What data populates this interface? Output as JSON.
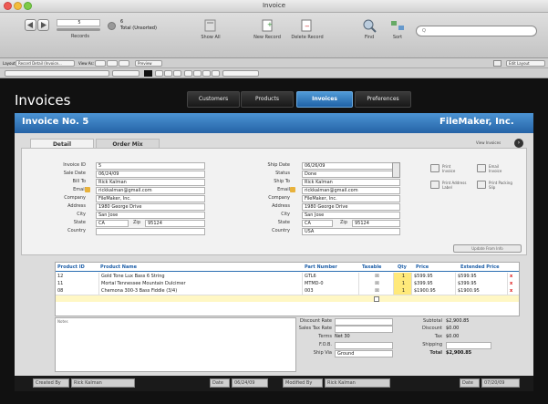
{
  "window": {
    "title": "Invoice"
  },
  "toolbar": {
    "record_value": "5",
    "records_label": "Records",
    "total_count": "6",
    "total_label": "Total (Unsorted)",
    "show_all": "Show All",
    "new_record": "New Record",
    "delete_record": "Delete Record",
    "find": "Find",
    "sort": "Sort",
    "search_placeholder": "Q"
  },
  "layoutbar": {
    "layout_label": "Layout:",
    "layout_value": "Record Detail (Invoice...",
    "view_as": "View As:",
    "preview": "Preview",
    "edit_layout": "Edit Layout"
  },
  "header": {
    "app_title": "Invoices",
    "tabs": [
      "Customers",
      "Products",
      "Invoices",
      "Preferences"
    ],
    "active_tab": "Invoices"
  },
  "invoice": {
    "title": "Invoice No. 5",
    "company": "FileMaker, Inc.",
    "subtabs": [
      "Detail",
      "Order Mix"
    ],
    "view_invoices": "View Invoices"
  },
  "billing": {
    "labels": [
      "Invoice ID",
      "Sale Date",
      "Bill To",
      "Email",
      "Company",
      "Address",
      "City",
      "State",
      "Zip",
      "Country"
    ],
    "invoice_id": "5",
    "sale_date": "06/24/09",
    "bill_to": "Rick Kalman",
    "email": "rickkalman@gmail.com",
    "company": "FileMaker, Inc.",
    "address": "1980 George Drive",
    "city": "San Jose",
    "state": "CA",
    "zip": "95124",
    "country": ""
  },
  "shipping": {
    "labels": [
      "Ship Date",
      "Status",
      "Ship To",
      "Email",
      "Company",
      "Address",
      "City",
      "State",
      "Zip",
      "Country"
    ],
    "ship_date": "06/26/09",
    "status": "Done",
    "ship_to": "Rick Kalman",
    "email": "rickkalman@gmail.com",
    "company": "FileMaker, Inc.",
    "address": "1980 George Drive",
    "city": "San Jose",
    "state": "CA",
    "zip": "95124",
    "country": "USA"
  },
  "actions": {
    "print_invoice": "Print Invoice",
    "email_invoice": "Email Invoice",
    "print_address_label": "Print Address Label",
    "print_packing_slip": "Print Packing Slip",
    "update_button": "Update From Info"
  },
  "line_items": {
    "columns": [
      "Product ID",
      "Product Name",
      "Part Number",
      "Taxable",
      "Qty",
      "Price",
      "Extended Price"
    ],
    "rows": [
      {
        "id": "12",
        "name": "Gold Tone Lux Bass 6 String",
        "part": "GTL6",
        "taxable": "☒",
        "qty": "1",
        "price": "$599.95",
        "ext": "$599.95"
      },
      {
        "id": "11",
        "name": "Mortal Tennessee Mountain Dulcimer",
        "part": "MTMD-0",
        "taxable": "☒",
        "qty": "1",
        "price": "$399.95",
        "ext": "$399.95"
      },
      {
        "id": "08",
        "name": "Chemona 300-3 Bass Fiddle (3/4)",
        "part": "003",
        "taxable": "☒",
        "qty": "1",
        "price": "$1900.95",
        "ext": "$1900.95"
      }
    ]
  },
  "notes": {
    "label": "Notes"
  },
  "totals": {
    "discount_rate_label": "Discount Rate",
    "sales_tax_label": "Sales Tax Rate",
    "terms_label": "Terms",
    "terms_value": "Net 30",
    "fob_label": "F.O.B.",
    "ship_via_label": "Ship Via",
    "ship_via_value": "Ground",
    "subtotal_label": "Subtotal",
    "subtotal_value": "$2,900.85",
    "discount_label": "Discount",
    "discount_value": "$0.00",
    "tax_label": "Tax",
    "tax_value": "$0.00",
    "shipping_label": "Shipping",
    "shipping_value": "",
    "total_label": "Total",
    "total_value": "$2,900.85"
  },
  "footer": {
    "created_by_label": "Created By",
    "created_by": "Rick Kalman",
    "created_date_label": "Date",
    "created_date": "06/24/09",
    "modified_by_label": "Modified By",
    "modified_by": "Rick Kalman",
    "modified_date_label": "Date",
    "modified_date": "07/20/09"
  },
  "colors": {
    "accent": "#2a6db2",
    "qty_highlight": "#ffe97a",
    "delete": "#d11111"
  }
}
